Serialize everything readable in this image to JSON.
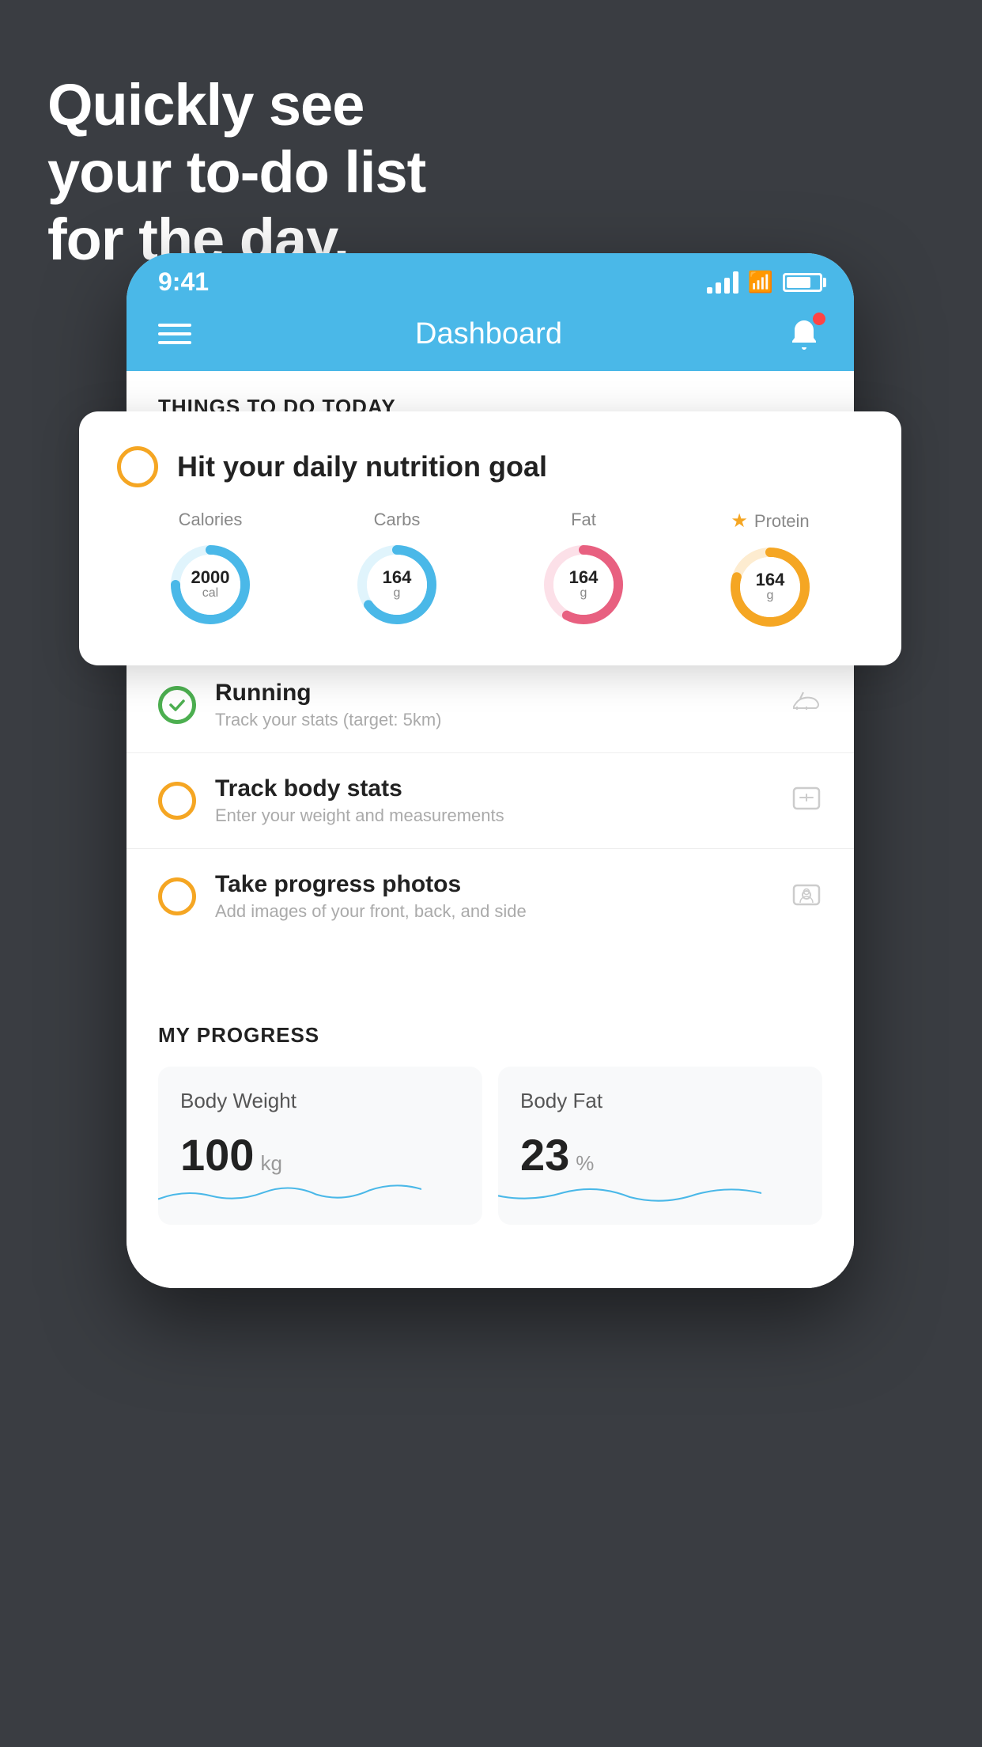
{
  "headline": {
    "line1": "Quickly see",
    "line2": "your to-do list",
    "line3": "for the day."
  },
  "status_bar": {
    "time": "9:41"
  },
  "nav": {
    "title": "Dashboard"
  },
  "things_header": "THINGS TO DO TODAY",
  "floating_card": {
    "title": "Hit your daily nutrition goal",
    "nutrition": [
      {
        "label": "Calories",
        "value": "2000",
        "unit": "cal",
        "color": "#4ab8e8",
        "is_star": false
      },
      {
        "label": "Carbs",
        "value": "164",
        "unit": "g",
        "color": "#4ab8e8",
        "is_star": false
      },
      {
        "label": "Fat",
        "value": "164",
        "unit": "g",
        "color": "#e86080",
        "is_star": false
      },
      {
        "label": "Protein",
        "value": "164",
        "unit": "g",
        "color": "#f5a623",
        "is_star": true
      }
    ]
  },
  "todo_items": [
    {
      "title": "Running",
      "subtitle": "Track your stats (target: 5km)",
      "circle_color": "green",
      "icon": "shoe"
    },
    {
      "title": "Track body stats",
      "subtitle": "Enter your weight and measurements",
      "circle_color": "yellow",
      "icon": "scale"
    },
    {
      "title": "Take progress photos",
      "subtitle": "Add images of your front, back, and side",
      "circle_color": "yellow",
      "icon": "photo"
    }
  ],
  "progress": {
    "header": "MY PROGRESS",
    "cards": [
      {
        "title": "Body Weight",
        "value": "100",
        "unit": "kg"
      },
      {
        "title": "Body Fat",
        "value": "23",
        "unit": "%"
      }
    ]
  }
}
